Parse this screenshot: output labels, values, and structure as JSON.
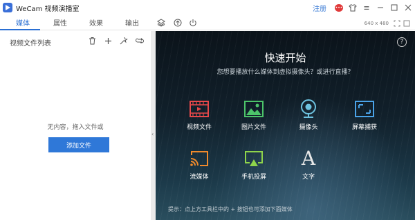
{
  "app": {
    "title": "WeCam 视频演播室",
    "register_label": "注册",
    "title_icons": [
      "message-icon",
      "shirt-icon",
      "menu-icon",
      "minimize-icon",
      "maximize-icon",
      "close-icon"
    ]
  },
  "tabs": [
    {
      "label": "媒体",
      "active": true
    },
    {
      "label": "属性",
      "active": false
    },
    {
      "label": "效果",
      "active": false
    },
    {
      "label": "输出",
      "active": false
    }
  ],
  "toolbar_icons": [
    "layers-icon",
    "upload-icon",
    "power-icon"
  ],
  "resolution": "640 x 480",
  "left_panel": {
    "title": "视频文件列表",
    "tools": [
      "trash-icon",
      "plus-icon",
      "magic-wand-icon",
      "loop-icon"
    ],
    "empty_text": "无内容，拖入文件或",
    "add_button": "添加文件"
  },
  "preview": {
    "title": "快速开始",
    "subtitle": "您想要播放什么媒体到虚拟摄像头？或进行直播？",
    "sources": [
      {
        "label": "视频文件",
        "icon": "film-icon",
        "color": "#e8494b"
      },
      {
        "label": "图片文件",
        "icon": "image-icon",
        "color": "#4cc46a"
      },
      {
        "label": "摄像头",
        "icon": "webcam-icon",
        "color": "#6ec3e0"
      },
      {
        "label": "屏幕捕获",
        "icon": "screen-capture-icon",
        "color": "#4aa3e8"
      },
      {
        "label": "流媒体",
        "icon": "cast-icon",
        "color": "#f08a2c"
      },
      {
        "label": "手机投屏",
        "icon": "airplay-icon",
        "color": "#8fd44b"
      },
      {
        "label": "文字",
        "icon": "text-icon",
        "color": "#e8e8e8"
      }
    ],
    "hint": "提示：点上方工具栏中的 + 按钮也可添加下面媒体"
  }
}
